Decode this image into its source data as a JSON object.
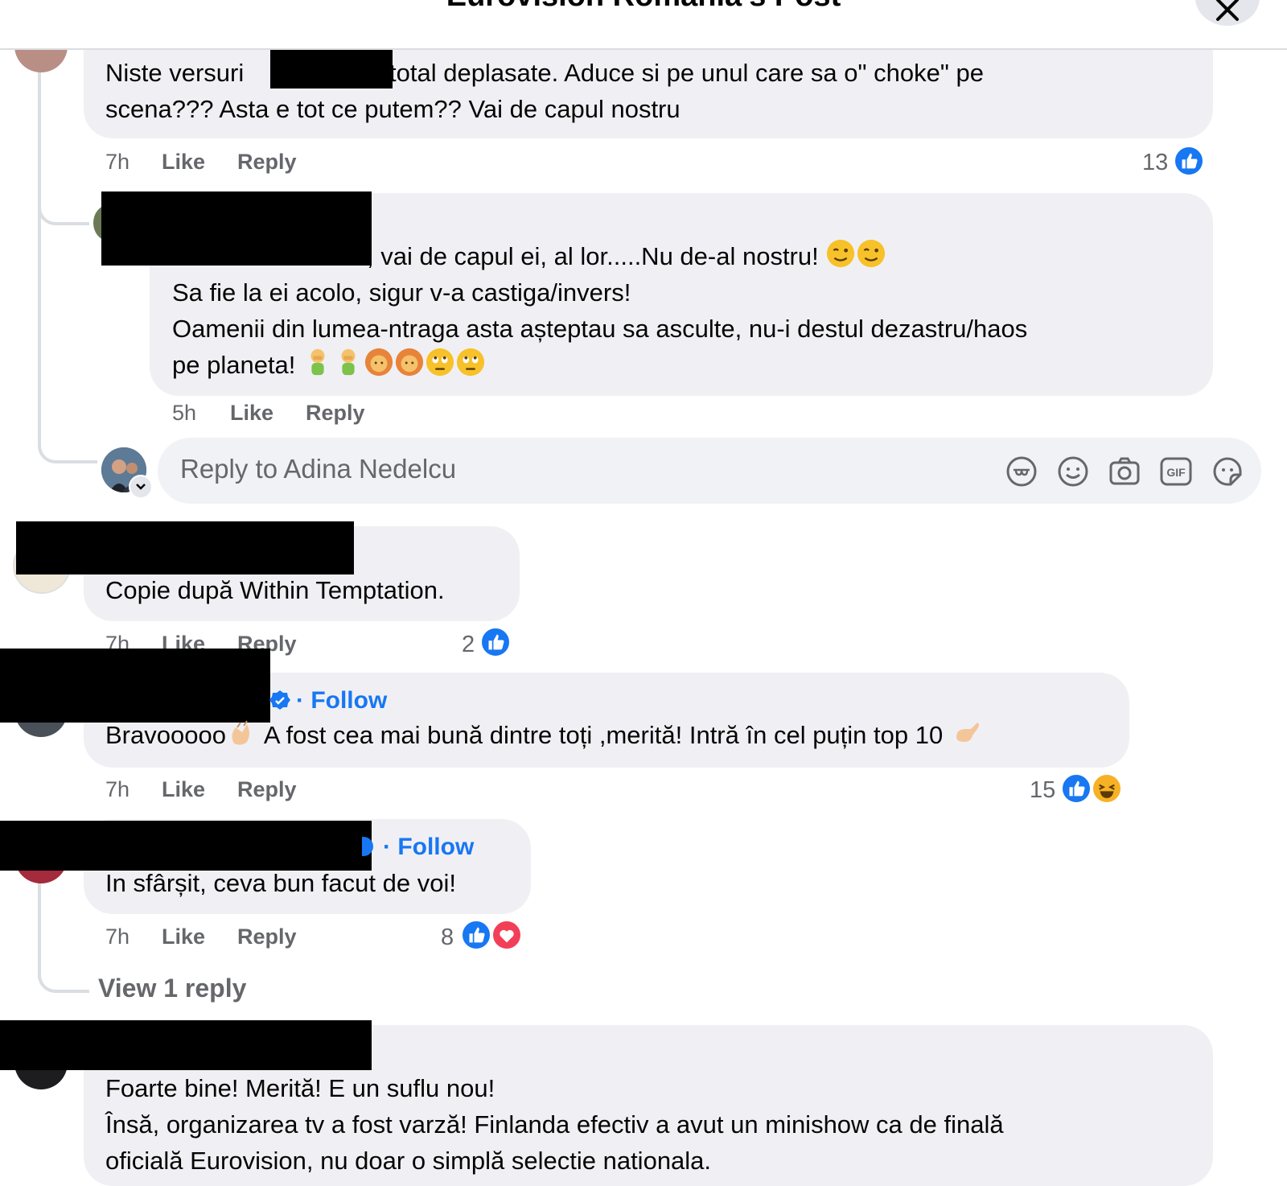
{
  "header": {
    "title": "Eurovision Romania's Post"
  },
  "comments": [
    {
      "lines": [
        "Niste versuri",
        "total deplasate. Aduce si pe unul care sa o\" choke\" pe",
        "scena??? Asta e tot ce putem?? Vai de capul nostru"
      ],
      "time": "7h",
      "like": "Like",
      "reply": "Reply",
      "reactions_count": "13"
    },
    {
      "lines": [
        ", vai de capul ei, al lor.....Nu de-al nostru!",
        "Sa fie la ei acolo, sigur v-a castiga/invers!",
        "Oamenii din lumea-ntraga asta așteptau sa asculte, nu-i destul dezastru/haos",
        "pe planeta!"
      ],
      "time": "5h",
      "like": "Like",
      "reply": "Reply"
    },
    {
      "lines": [
        "Copie după Within Temptation."
      ],
      "time": "7h",
      "like": "Like",
      "reply": "Reply",
      "reactions_count": "2"
    },
    {
      "follow": "· Follow",
      "lines": [
        "Bravooooo",
        "A fost cea mai bună dintre toți ,merită! Intră în cel puțin top 10"
      ],
      "time": "7h",
      "like": "Like",
      "reply": "Reply",
      "reactions_count": "15"
    },
    {
      "follow": "· Follow",
      "lines": [
        "In sfârșit, ceva bun facut de voi!"
      ],
      "time": "7h",
      "like": "Like",
      "reply": "Reply",
      "reactions_count": "8",
      "view_replies": "View 1 reply"
    },
    {
      "lines": [
        "Foarte bine! Merită! E un suflu nou!",
        "Însă, organizarea tv a fost varză! Finlanda efectiv a avut un minishow ca de finală",
        "oficială Eurovision, nu doar o simplă selectie nationala."
      ]
    }
  ],
  "reply_box": {
    "placeholder": "Reply to Adina Nedelcu",
    "gif_label": "GIF"
  },
  "colors": {
    "accent": "#1877f2",
    "bubble": "#f0f0f4",
    "meta": "#65676b",
    "love": "#f33e58",
    "haha": "#f7b125"
  },
  "icons": [
    "close-icon",
    "like-icon",
    "love-icon",
    "haha-icon",
    "verified-badge-icon",
    "avatar-sticker-icon",
    "emoji-icon",
    "camera-icon",
    "gif-icon",
    "sticker-icon",
    "chevron-down-icon"
  ]
}
